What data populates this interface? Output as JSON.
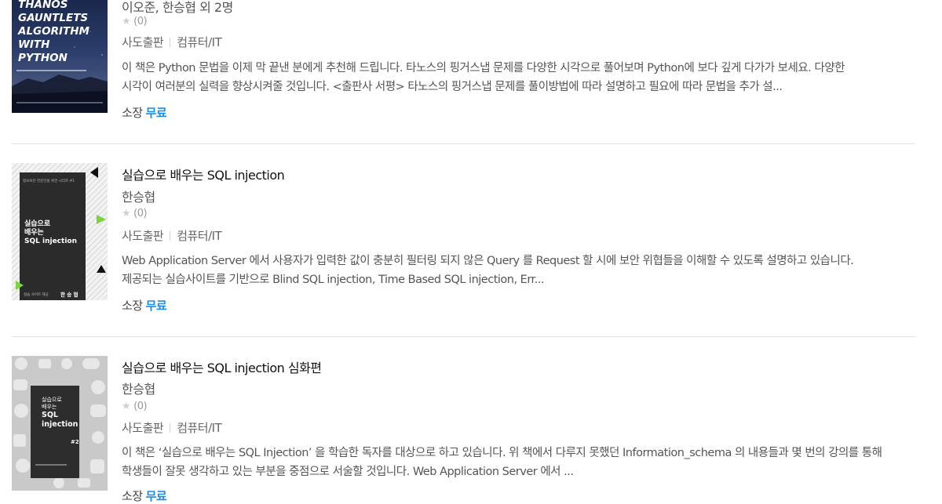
{
  "books": [
    {
      "cover": {
        "lines": [
          "THANOS",
          "GAUNTLETS",
          "ALGORITHM",
          "WITH",
          "PYTHON"
        ],
        "bg": "#101a33"
      },
      "title": "",
      "author": "이오준, 한승협 외 2명",
      "rating": "(0)",
      "publisher": "사도출판",
      "category": "컴퓨터/IT",
      "description": [
        "이 책은 Python 문법을 이제 막 끝낸 분에게 추천해 드립니다. 타노스의 핑거스냅 문제를 다양한 시각으로 풀어보며 Python에 보다 깊게 다가가 보세요. 다양한",
        "시각이 여러분의 실력을 향상시켜줄 것입니다. <출판사 서평> 타노스의 핑거스냅 문제를 풀이방법에 따라 설명하고 필요에 따라 문법을 추가 설..."
      ],
      "price_label": "소장",
      "price_value": "무료"
    },
    {
      "cover": {
        "top_text": "정보보안 전문인을 위한 시리즈 #1",
        "lines": [
          "실습으로",
          "배우는",
          "SQL injection"
        ],
        "bottom_left": "실습 사이트 제공",
        "bottom_right": "한 승 협",
        "bg": "#2b2b2b"
      },
      "title": "실습으로 배우는 SQL injection",
      "author": "한승협",
      "rating": "(0)",
      "publisher": "사도출판",
      "category": "컴퓨터/IT",
      "description": [
        "Web Application Server 에서 사용자가 입력한 값이 충분히 필터링 되지 않은 Query 를 Request 할 시에 보안 위협들을 이해할 수 있도록 설명하고 있습니다.",
        "제공되는 실습사이트를 기반으로 Blind SQL injection, Time Based SQL injection, Err..."
      ],
      "price_label": "소장",
      "price_value": "무료"
    },
    {
      "cover": {
        "lines": [
          "실습으로",
          "배우는",
          "SQL",
          "injection"
        ],
        "badge": "#2",
        "bg": "#cfcfcf"
      },
      "title": "실습으로 배우는 SQL injection 심화편",
      "author": "한승협",
      "rating": "(0)",
      "publisher": "사도출판",
      "category": "컴퓨터/IT",
      "description": [
        "이 책은 ‘실습으로 배우는 SQL Injection’ 을 학습한 독자를 대상으로 하고 있습니다. 위 책에서 다루지 못했던 Information_schema 의 내용들과 몇 번의 강의를 통해",
        "학생들이 잘못 생각하고 있는 부분을 중점으로 서술할 것입니다. Web Application Server 에서 ..."
      ],
      "price_label": "소장",
      "price_value": "무료"
    }
  ],
  "colors": {
    "accent": "#1f8ce6",
    "divider": "#e2e2e2"
  },
  "icons": [
    "star-icon"
  ]
}
